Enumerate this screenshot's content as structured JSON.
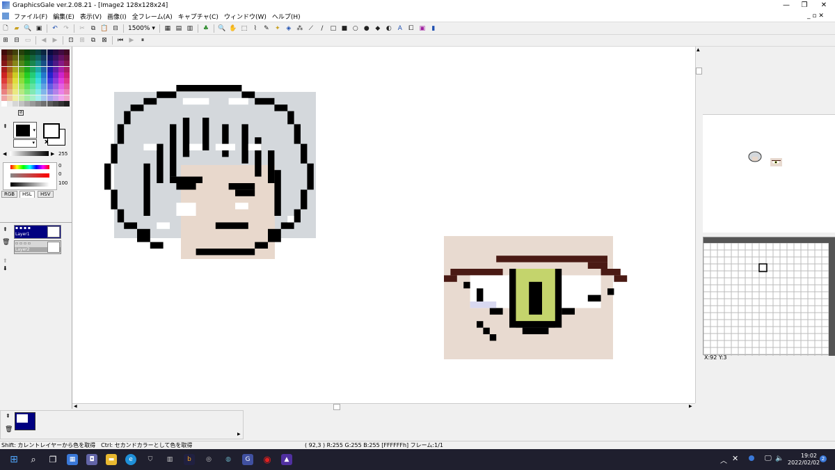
{
  "app": {
    "title": "GraphicsGale ver.2.08.21 - [Image2 128x128x24]"
  },
  "menu": [
    "ファイル(F)",
    "編集(E)",
    "表示(V)",
    "画像(I)",
    "全フレーム(A)",
    "キャプチャ(C)",
    "ウィンドウ(W)",
    "ヘルプ(H)"
  ],
  "toolbar": {
    "zoom": "1500%"
  },
  "color_panel": {
    "alpha_value": "255",
    "h_value": "0",
    "s_value": "0",
    "l_value": "100",
    "tabs": [
      "RGB",
      "HSL",
      "HSV"
    ],
    "active_tab": "HSL"
  },
  "layers": [
    {
      "name": "Layer1",
      "selected": true
    },
    {
      "name": "Layer2",
      "selected": false
    }
  ],
  "preview": {
    "coords": "X:92 Y:3"
  },
  "status": {
    "hint": "Shift: カレントレイヤーから色を取得　Ctrl: セカンドカラーとして色を取得",
    "info": "( 92,3 ) R:255 G:255 B:255  [FFFFFFh]  フレーム:1/1"
  },
  "clock": {
    "time": "19:02",
    "date": "2022/02/02"
  },
  "colors": {
    "selection": "#000080",
    "hair": "#d4d8dc",
    "skin": "#e8d8cc",
    "outline": "#000000",
    "eye_bg": "#e8dad0",
    "iris": "#c4d46c",
    "lash": "#4a1a14",
    "taskbar": "#1f1f2e"
  }
}
